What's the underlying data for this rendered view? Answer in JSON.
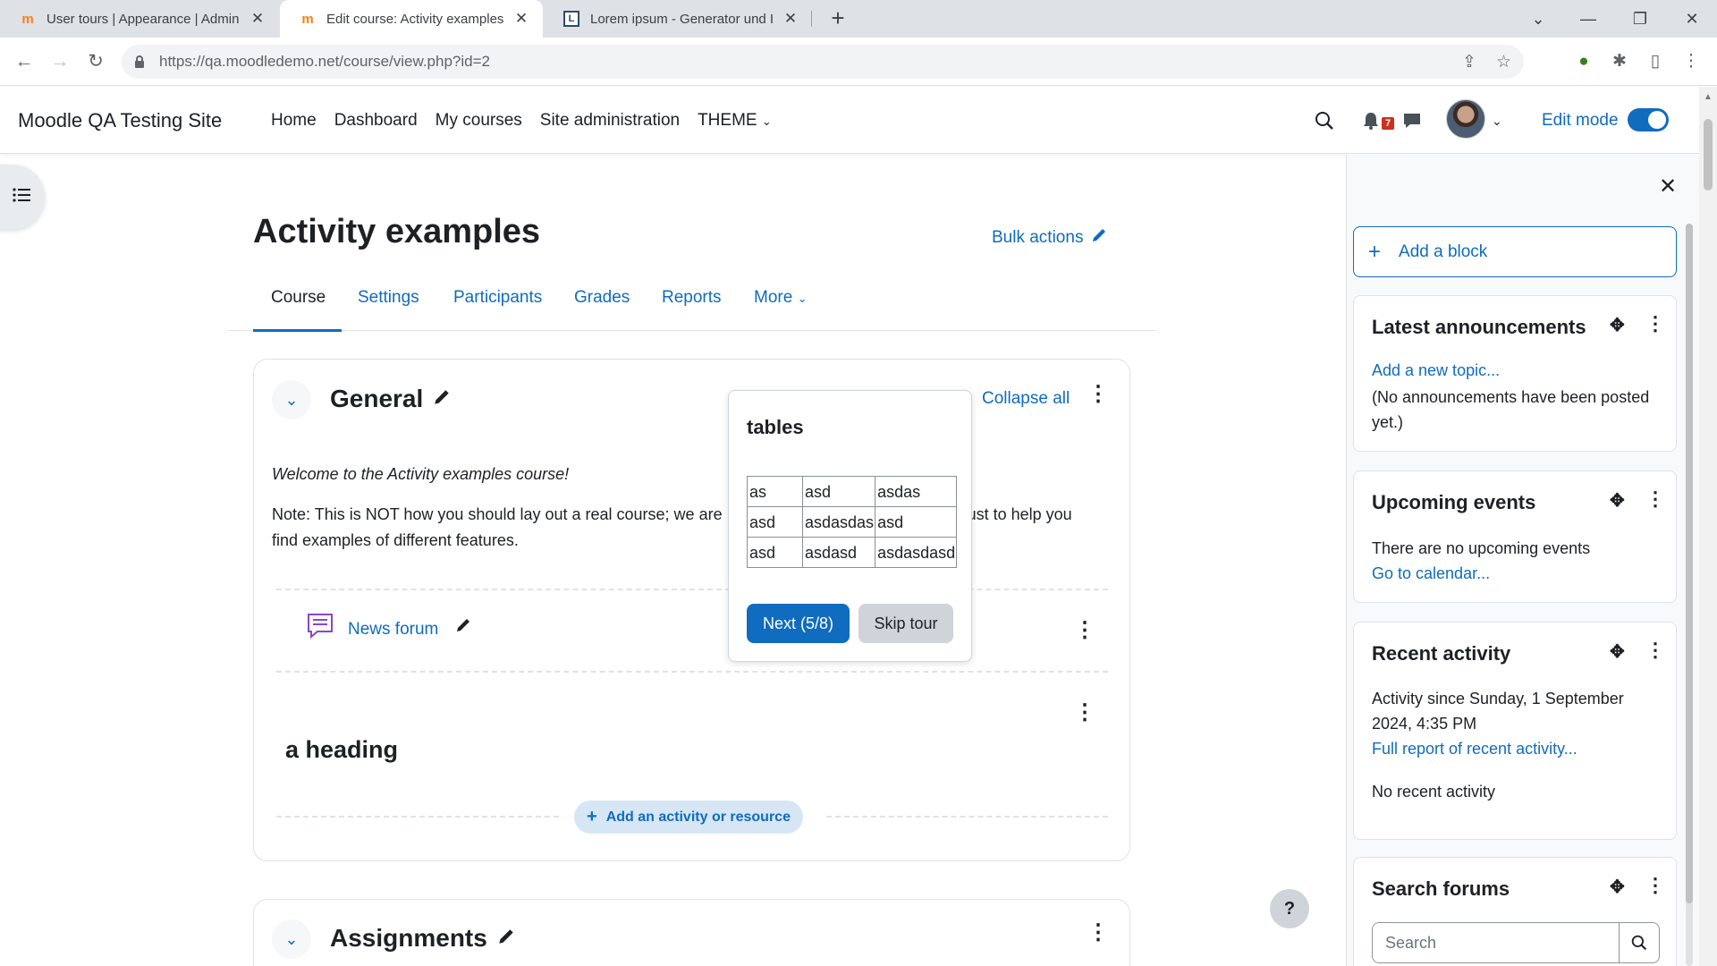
{
  "browser": {
    "tabs": [
      {
        "title": "User tours | Appearance | Admini",
        "active": false
      },
      {
        "title": "Edit course: Activity examples | M",
        "active": true
      },
      {
        "title": "Lorem ipsum - Generator und Inf",
        "active": false
      }
    ],
    "url_host": "https://qa.moodledemo.net",
    "url_path": "/course/view.php?id=2"
  },
  "navbar": {
    "site_name": "Moodle QA Testing Site",
    "links": [
      "Home",
      "Dashboard",
      "My courses",
      "Site administration",
      "THEME"
    ],
    "notification_count": "7",
    "edit_mode_label": "Edit mode",
    "edit_mode_on": true
  },
  "course": {
    "title": "Activity examples",
    "bulk_actions": "Bulk actions",
    "tabs": [
      "Course",
      "Settings",
      "Participants",
      "Grades",
      "Reports",
      "More"
    ],
    "active_tab": "Course",
    "collapse_all": "Collapse all"
  },
  "sections": {
    "general": {
      "title": "General",
      "summary_line1": "Welcome to the Activity examples course!",
      "summary_line2a": "Note: This is NOT how you should lay out a real course; we are",
      "summary_line2b": "just to help you",
      "summary_line3": "find examples of different features.",
      "activity": "News forum",
      "heading": "a heading",
      "add_activity": "Add an activity or resource"
    },
    "assignments": {
      "title": "Assignments"
    }
  },
  "tour": {
    "title": "tables",
    "table": [
      [
        "as",
        "asd",
        "asdas"
      ],
      [
        "asd",
        "asdasdas",
        "asd"
      ],
      [
        "asd",
        "asdasd",
        "asdasdasd"
      ]
    ],
    "next_label": "Next (5/8)",
    "skip_label": "Skip tour"
  },
  "drawer": {
    "add_block": "Add a block",
    "latest": {
      "title": "Latest announcements",
      "link": "Add a new topic...",
      "text": "(No announcements have been posted yet.)"
    },
    "upcoming": {
      "title": "Upcoming events",
      "text": "There are no upcoming events",
      "link": "Go to calendar..."
    },
    "recent": {
      "title": "Recent activity",
      "text": "Activity since Sunday, 1 September 2024, 4:35 PM",
      "link": "Full report of recent activity...",
      "empty": "No recent activity"
    },
    "search": {
      "title": "Search forums",
      "placeholder": "Search"
    }
  },
  "help_label": "?",
  "colors": {
    "primary": "#0f6cbf",
    "badge": "#ca3120",
    "text": "#1d2125"
  }
}
